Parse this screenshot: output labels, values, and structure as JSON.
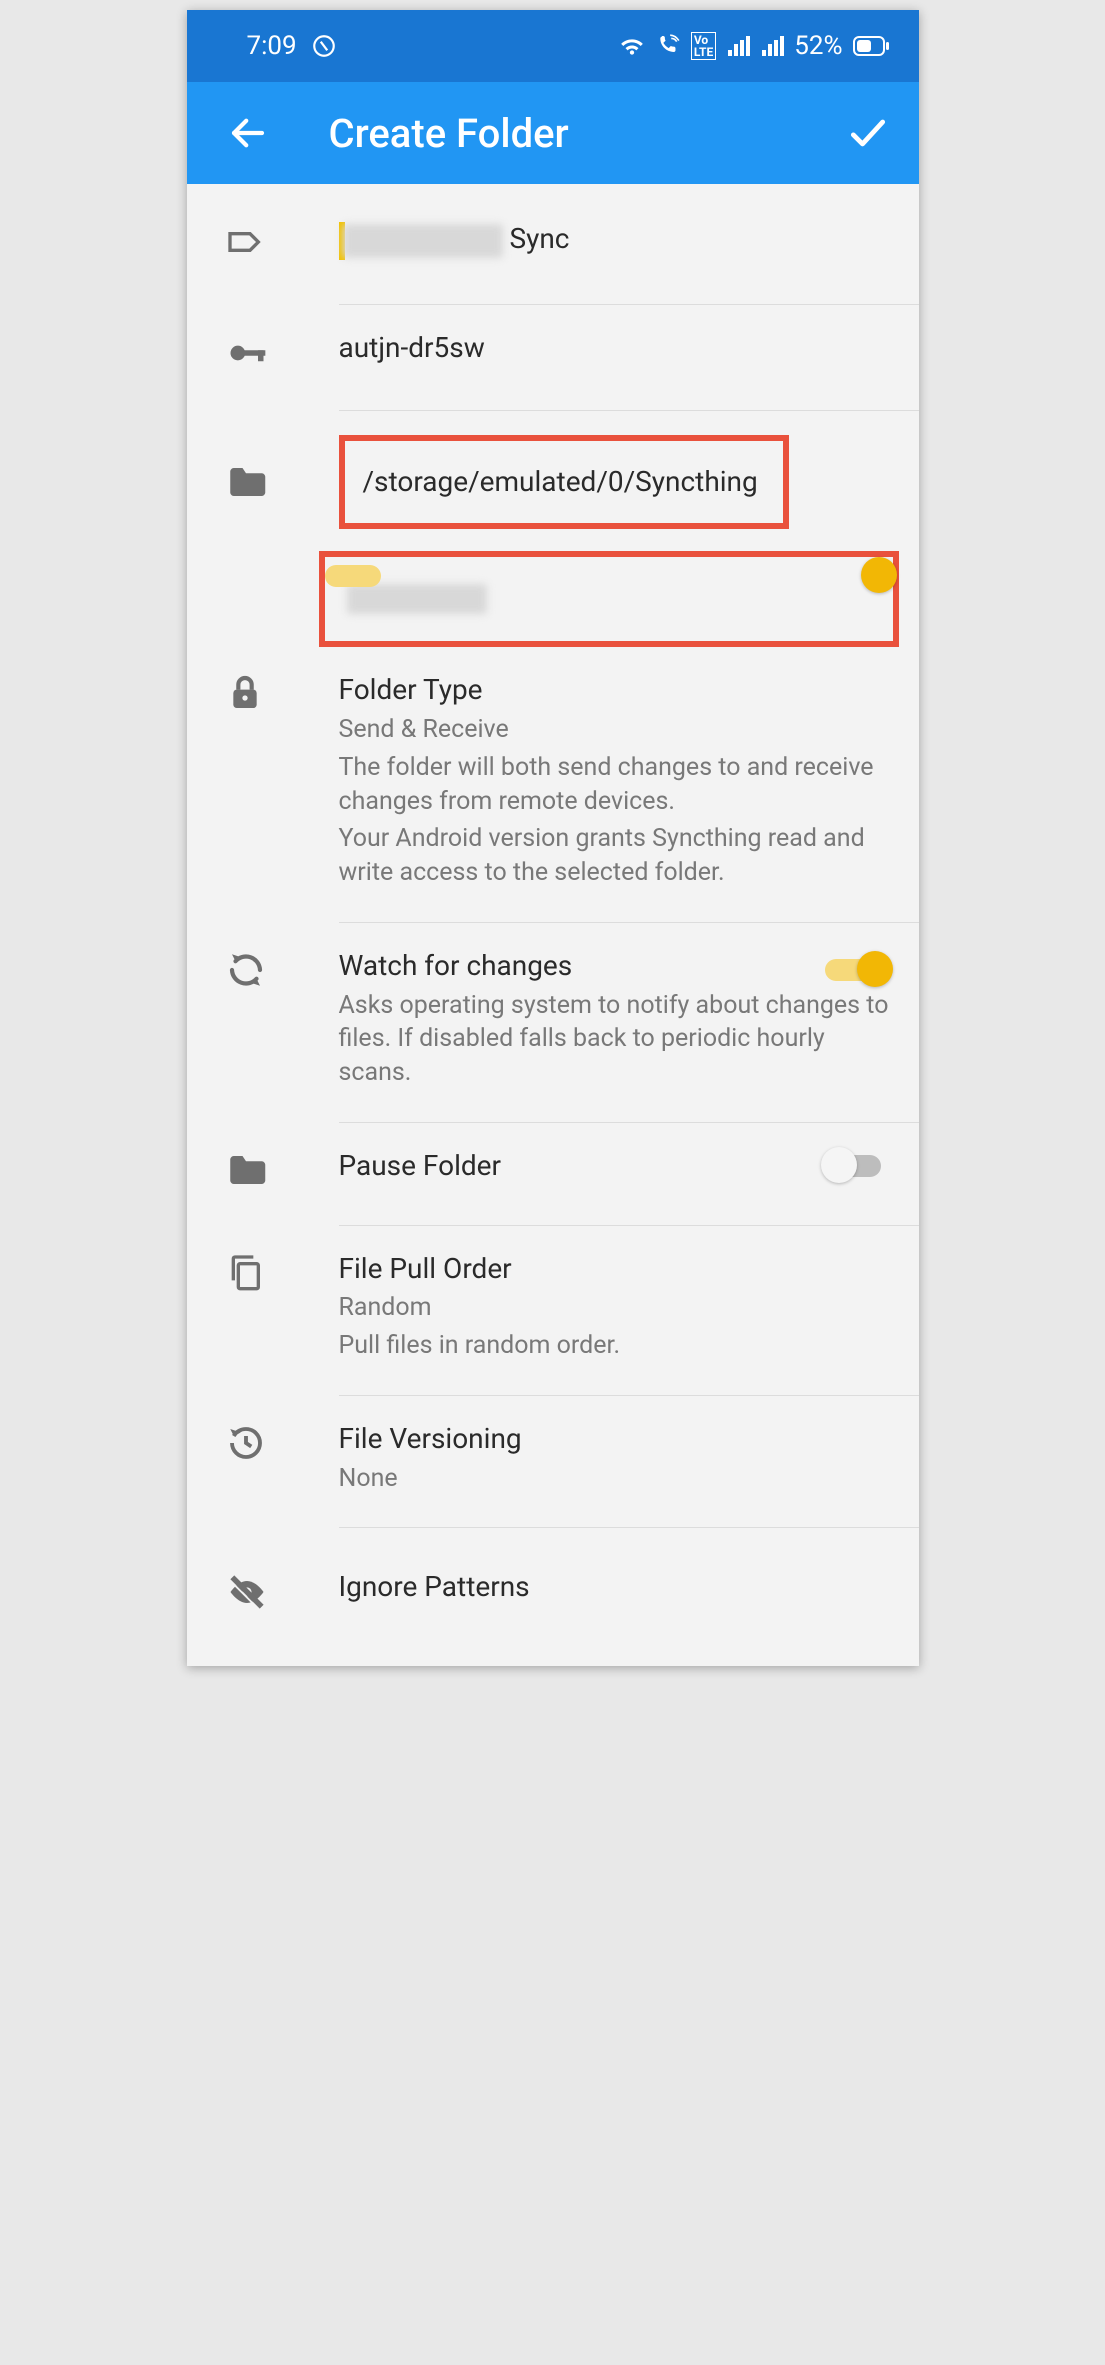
{
  "status": {
    "time": "7:09",
    "battery": "52%"
  },
  "appbar": {
    "title": "Create Folder"
  },
  "folder": {
    "label_redacted": "XXXXXXXX",
    "label_suffix": " Sync",
    "id": "autjn-dr5sw",
    "path": "/storage/emulated/0/Syncthing"
  },
  "device": {
    "name_redacted": "XXXXXXXX"
  },
  "folder_type": {
    "title": "Folder Type",
    "value": "Send & Receive",
    "desc1": "The folder will both send changes to and receive changes from remote devices.",
    "desc2": "Your Android version grants Syncthing read and write access to the selected folder."
  },
  "watch": {
    "title": "Watch for changes",
    "desc": "Asks operating system to notify about changes to files. If disabled falls back to periodic hourly scans."
  },
  "pause": {
    "title": "Pause Folder"
  },
  "pull": {
    "title": "File Pull Order",
    "value": "Random",
    "desc": "Pull files in random order."
  },
  "versioning": {
    "title": "File Versioning",
    "value": "None"
  },
  "ignore": {
    "title": "Ignore Patterns"
  }
}
